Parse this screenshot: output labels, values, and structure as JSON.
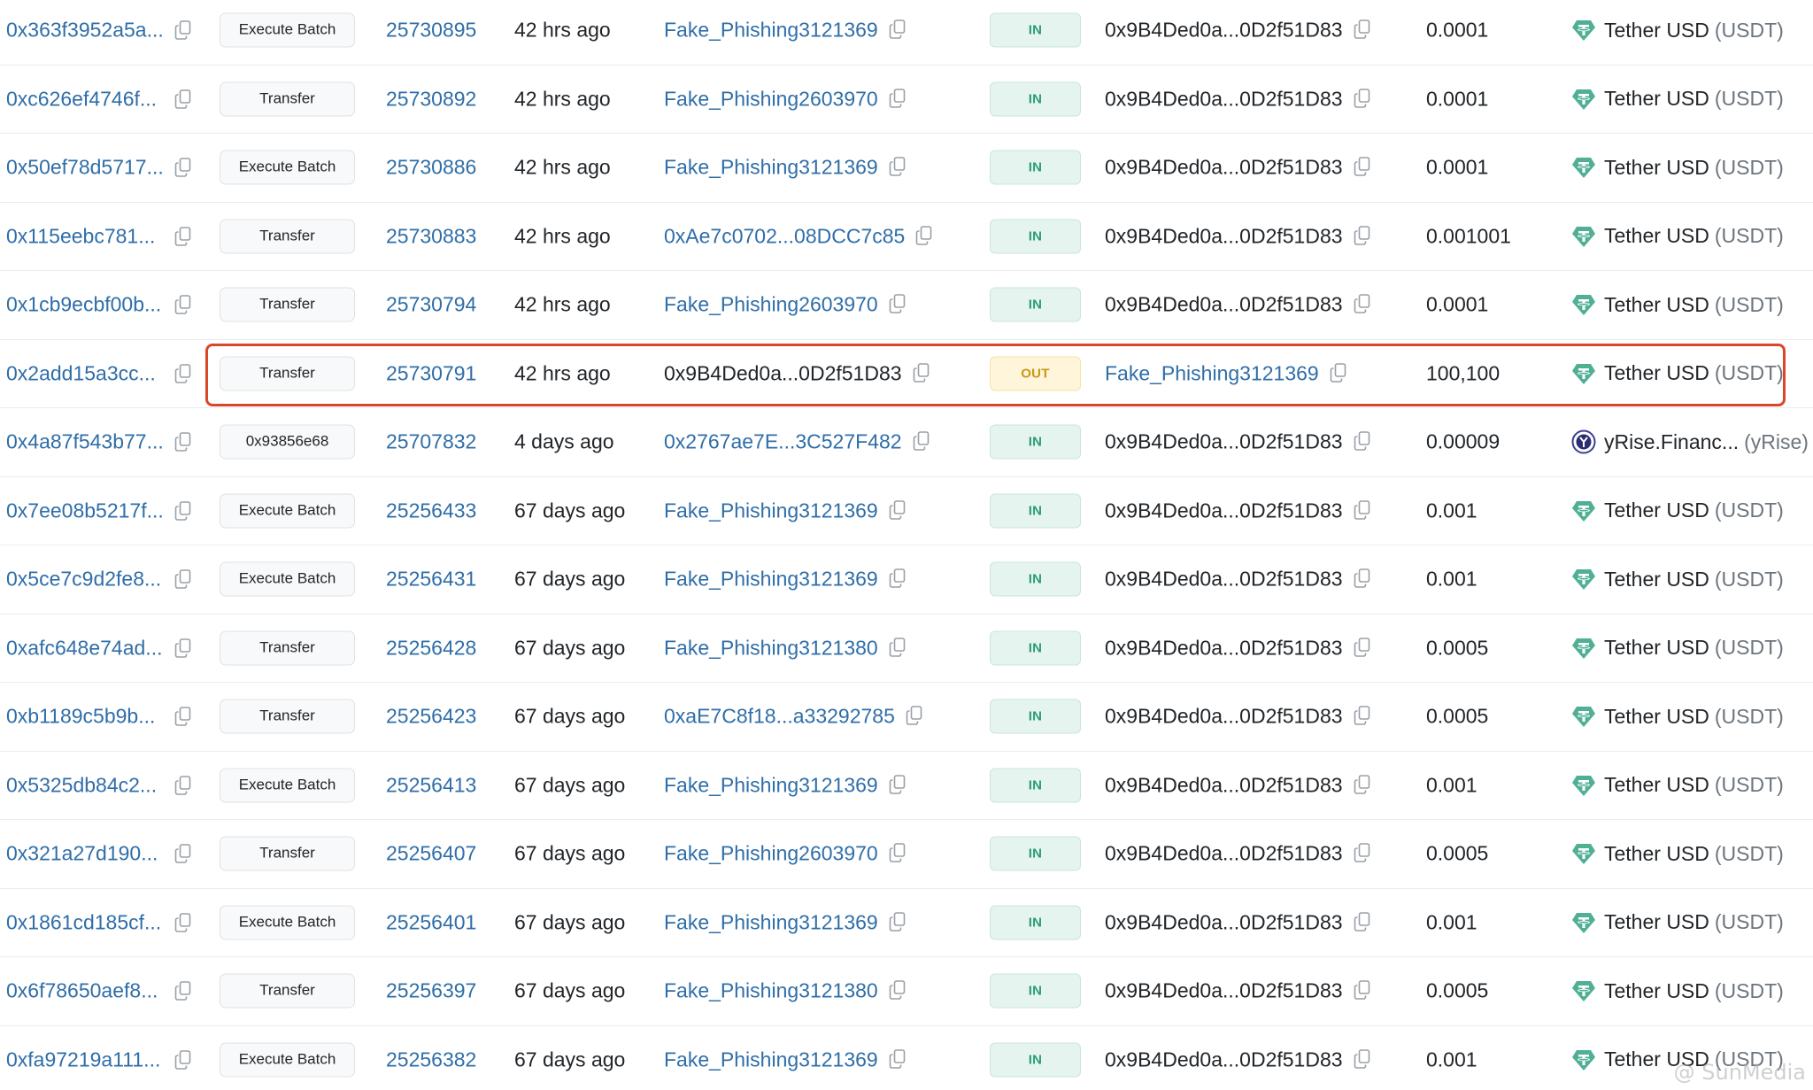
{
  "colors": {
    "link": "#2f6ea8",
    "in_badge_bg": "#e6f4ef",
    "in_badge_text": "#2a9d74",
    "out_badge_bg": "#fff5da",
    "out_badge_text": "#c79718",
    "highlight_border": "#d9472b",
    "tether_green": "#50af95"
  },
  "icons": {
    "copy": "copy-icon",
    "tether": "tether-usdt-icon",
    "yrise": "yrise-token-icon"
  },
  "rows": [
    {
      "hash": "0x363f3952a5a...",
      "method": "Execute Batch",
      "block": "25730895",
      "age": "42 hrs ago",
      "from": "Fake_Phishing3121369",
      "from_link": true,
      "direction": "IN",
      "to": "0x9B4Ded0a...0D2f51D83",
      "to_link": false,
      "quantity": "0.0001",
      "token_name": "Tether USD",
      "token_symbol": "(USDT)",
      "token_icon": "tether"
    },
    {
      "hash": "0xc626ef4746f...",
      "method": "Transfer",
      "block": "25730892",
      "age": "42 hrs ago",
      "from": "Fake_Phishing2603970",
      "from_link": true,
      "direction": "IN",
      "to": "0x9B4Ded0a...0D2f51D83",
      "to_link": false,
      "quantity": "0.0001",
      "token_name": "Tether USD",
      "token_symbol": "(USDT)",
      "token_icon": "tether"
    },
    {
      "hash": "0x50ef78d5717...",
      "method": "Execute Batch",
      "block": "25730886",
      "age": "42 hrs ago",
      "from": "Fake_Phishing3121369",
      "from_link": true,
      "direction": "IN",
      "to": "0x9B4Ded0a...0D2f51D83",
      "to_link": false,
      "quantity": "0.0001",
      "token_name": "Tether USD",
      "token_symbol": "(USDT)",
      "token_icon": "tether"
    },
    {
      "hash": "0x115eebc781...",
      "method": "Transfer",
      "block": "25730883",
      "age": "42 hrs ago",
      "from": "0xAe7c0702...08DCC7c85",
      "from_link": true,
      "direction": "IN",
      "to": "0x9B4Ded0a...0D2f51D83",
      "to_link": false,
      "quantity": "0.001001",
      "token_name": "Tether USD",
      "token_symbol": "(USDT)",
      "token_icon": "tether"
    },
    {
      "hash": "0x1cb9ecbf00b...",
      "method": "Transfer",
      "block": "25730794",
      "age": "42 hrs ago",
      "from": "Fake_Phishing2603970",
      "from_link": true,
      "direction": "IN",
      "to": "0x9B4Ded0a...0D2f51D83",
      "to_link": false,
      "quantity": "0.0001",
      "token_name": "Tether USD",
      "token_symbol": "(USDT)",
      "token_icon": "tether"
    },
    {
      "hash": "0x2add15a3cc...",
      "method": "Transfer",
      "block": "25730791",
      "age": "42 hrs ago",
      "from": "0x9B4Ded0a...0D2f51D83",
      "from_link": false,
      "direction": "OUT",
      "to": "Fake_Phishing3121369",
      "to_link": true,
      "quantity": "100,100",
      "token_name": "Tether USD",
      "token_symbol": "(USDT)",
      "token_icon": "tether"
    },
    {
      "hash": "0x4a87f543b77...",
      "method": "0x93856e68",
      "block": "25707832",
      "age": "4 days ago",
      "from": "0x2767ae7E...3C527F482",
      "from_link": true,
      "direction": "IN",
      "to": "0x9B4Ded0a...0D2f51D83",
      "to_link": false,
      "quantity": "0.00009",
      "token_name": "yRise.Financ...",
      "token_symbol": "(yRise)",
      "token_icon": "yrise"
    },
    {
      "hash": "0x7ee08b5217f...",
      "method": "Execute Batch",
      "block": "25256433",
      "age": "67 days ago",
      "from": "Fake_Phishing3121369",
      "from_link": true,
      "direction": "IN",
      "to": "0x9B4Ded0a...0D2f51D83",
      "to_link": false,
      "quantity": "0.001",
      "token_name": "Tether USD",
      "token_symbol": "(USDT)",
      "token_icon": "tether"
    },
    {
      "hash": "0x5ce7c9d2fe8...",
      "method": "Execute Batch",
      "block": "25256431",
      "age": "67 days ago",
      "from": "Fake_Phishing3121369",
      "from_link": true,
      "direction": "IN",
      "to": "0x9B4Ded0a...0D2f51D83",
      "to_link": false,
      "quantity": "0.001",
      "token_name": "Tether USD",
      "token_symbol": "(USDT)",
      "token_icon": "tether"
    },
    {
      "hash": "0xafc648e74ad...",
      "method": "Transfer",
      "block": "25256428",
      "age": "67 days ago",
      "from": "Fake_Phishing3121380",
      "from_link": true,
      "direction": "IN",
      "to": "0x9B4Ded0a...0D2f51D83",
      "to_link": false,
      "quantity": "0.0005",
      "token_name": "Tether USD",
      "token_symbol": "(USDT)",
      "token_icon": "tether"
    },
    {
      "hash": "0xb1189c5b9b...",
      "method": "Transfer",
      "block": "25256423",
      "age": "67 days ago",
      "from": "0xaE7C8f18...a33292785",
      "from_link": true,
      "direction": "IN",
      "to": "0x9B4Ded0a...0D2f51D83",
      "to_link": false,
      "quantity": "0.0005",
      "token_name": "Tether USD",
      "token_symbol": "(USDT)",
      "token_icon": "tether"
    },
    {
      "hash": "0x5325db84c2...",
      "method": "Execute Batch",
      "block": "25256413",
      "age": "67 days ago",
      "from": "Fake_Phishing3121369",
      "from_link": true,
      "direction": "IN",
      "to": "0x9B4Ded0a...0D2f51D83",
      "to_link": false,
      "quantity": "0.001",
      "token_name": "Tether USD",
      "token_symbol": "(USDT)",
      "token_icon": "tether"
    },
    {
      "hash": "0x321a27d190...",
      "method": "Transfer",
      "block": "25256407",
      "age": "67 days ago",
      "from": "Fake_Phishing2603970",
      "from_link": true,
      "direction": "IN",
      "to": "0x9B4Ded0a...0D2f51D83",
      "to_link": false,
      "quantity": "0.0005",
      "token_name": "Tether USD",
      "token_symbol": "(USDT)",
      "token_icon": "tether"
    },
    {
      "hash": "0x1861cd185cf...",
      "method": "Execute Batch",
      "block": "25256401",
      "age": "67 days ago",
      "from": "Fake_Phishing3121369",
      "from_link": true,
      "direction": "IN",
      "to": "0x9B4Ded0a...0D2f51D83",
      "to_link": false,
      "quantity": "0.001",
      "token_name": "Tether USD",
      "token_symbol": "(USDT)",
      "token_icon": "tether"
    },
    {
      "hash": "0x6f78650aef8...",
      "method": "Transfer",
      "block": "25256397",
      "age": "67 days ago",
      "from": "Fake_Phishing3121380",
      "from_link": true,
      "direction": "IN",
      "to": "0x9B4Ded0a...0D2f51D83",
      "to_link": false,
      "quantity": "0.0005",
      "token_name": "Tether USD",
      "token_symbol": "(USDT)",
      "token_icon": "tether"
    },
    {
      "hash": "0xfa97219a111...",
      "method": "Execute Batch",
      "block": "25256382",
      "age": "67 days ago",
      "from": "Fake_Phishing3121369",
      "from_link": true,
      "direction": "IN",
      "to": "0x9B4Ded0a...0D2f51D83",
      "to_link": false,
      "quantity": "0.001",
      "token_name": "Tether USD",
      "token_symbol": "(USDT)",
      "token_icon": "tether"
    }
  ],
  "highlighted_row": 5,
  "watermark": "@ SunMedia"
}
